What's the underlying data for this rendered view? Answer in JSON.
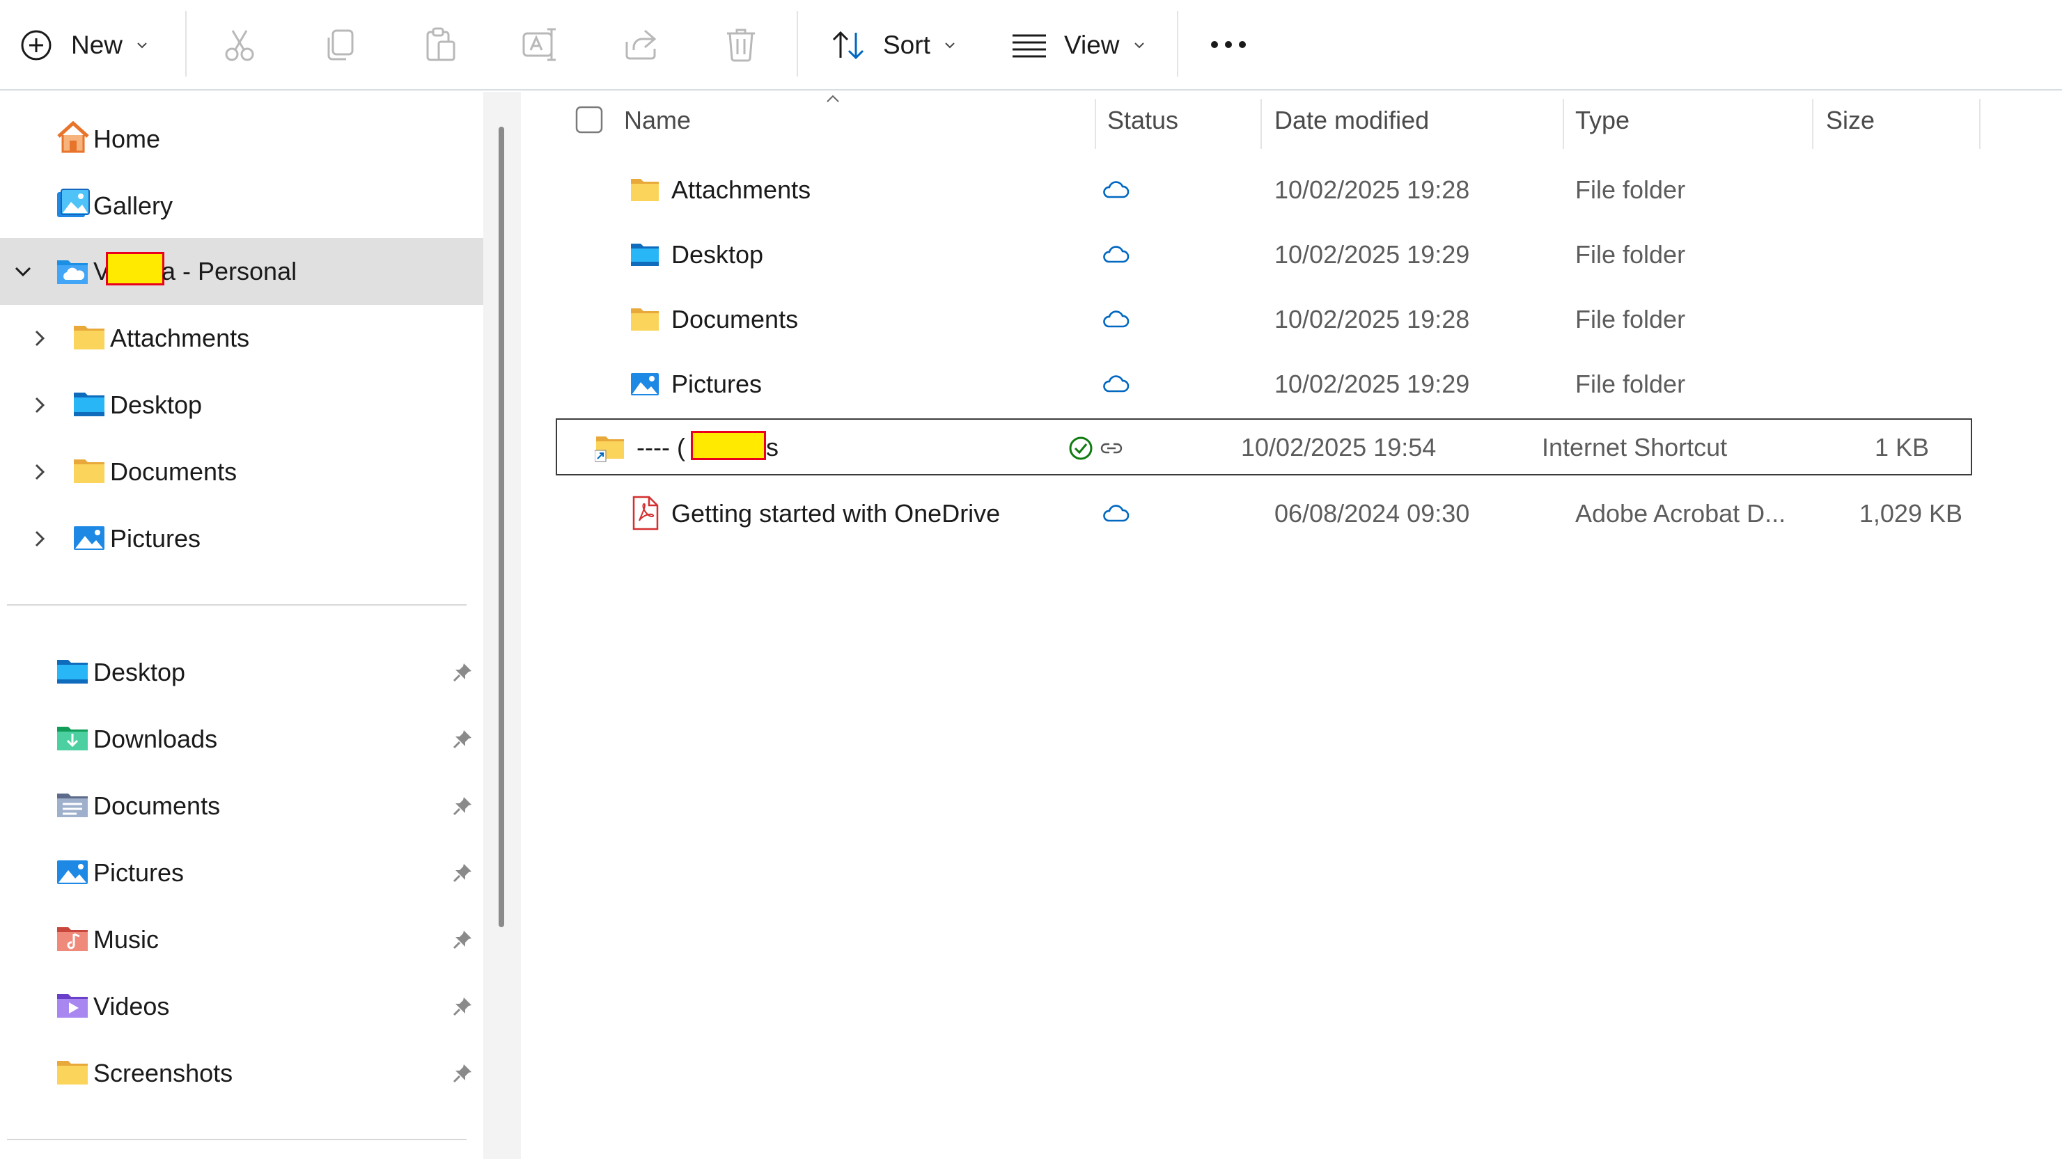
{
  "toolbar": {
    "new_label": "New",
    "sort_label": "Sort",
    "view_label": "View",
    "icons": [
      "plus-circle-icon",
      "cut-icon",
      "copy-icon",
      "paste-icon",
      "rename-icon",
      "share-icon",
      "delete-icon",
      "sort-icon",
      "view-icon",
      "more-icon"
    ]
  },
  "nav": {
    "top_items": [
      {
        "label": "Home",
        "icon": "home-icon"
      },
      {
        "label": "Gallery",
        "icon": "gallery-icon"
      }
    ],
    "onedrive": {
      "prefix": "V",
      "suffix": "a - Personal",
      "icon": "onedrive-folder-icon",
      "expanded": true
    },
    "onedrive_children": [
      {
        "label": "Attachments",
        "icon": "folder-icon"
      },
      {
        "label": "Desktop",
        "icon": "desktop-folder-icon"
      },
      {
        "label": "Documents",
        "icon": "folder-icon"
      },
      {
        "label": "Pictures",
        "icon": "pictures-folder-icon"
      }
    ],
    "quick_access": [
      {
        "label": "Desktop",
        "icon": "desktop-folder-icon"
      },
      {
        "label": "Downloads",
        "icon": "downloads-folder-icon"
      },
      {
        "label": "Documents",
        "icon": "documents-folder-icon"
      },
      {
        "label": "Pictures",
        "icon": "pictures-folder-icon"
      },
      {
        "label": "Music",
        "icon": "music-folder-icon"
      },
      {
        "label": "Videos",
        "icon": "videos-folder-icon"
      },
      {
        "label": "Screenshots",
        "icon": "folder-icon"
      }
    ]
  },
  "columns": {
    "name": "Name",
    "status": "Status",
    "date": "Date modified",
    "type": "Type",
    "size": "Size"
  },
  "files": [
    {
      "name": "Attachments",
      "status": "cloud",
      "date": "10/02/2025 19:28",
      "type": "File folder",
      "size": "",
      "icon": "folder-icon"
    },
    {
      "name": "Desktop",
      "status": "cloud",
      "date": "10/02/2025 19:29",
      "type": "File folder",
      "size": "",
      "icon": "desktop-folder-icon"
    },
    {
      "name": "Documents",
      "status": "cloud",
      "date": "10/02/2025 19:28",
      "type": "File folder",
      "size": "",
      "icon": "folder-icon"
    },
    {
      "name": "Pictures",
      "status": "cloud",
      "date": "10/02/2025 19:29",
      "type": "File folder",
      "size": "",
      "icon": "pictures-folder-icon"
    },
    {
      "name": "---- (",
      "name_suffix": "s",
      "status": "synced-shared",
      "date": "10/02/2025 19:54",
      "type": "Internet Shortcut",
      "size": "1 KB",
      "icon": "shortcut-folder-icon"
    },
    {
      "name": "Getting started with OneDrive",
      "status": "cloud",
      "date": "06/08/2024 09:30",
      "type": "Adobe Acrobat D...",
      "size": "1,029 KB",
      "icon": "pdf-icon"
    }
  ],
  "colors": {
    "accent": "#0067c0",
    "folder": "#f8c84a",
    "selected_bg": "#e0e0e0",
    "synced_green": "#107c10",
    "redaction_fill": "#ffea00",
    "redaction_border": "#e8001c"
  }
}
